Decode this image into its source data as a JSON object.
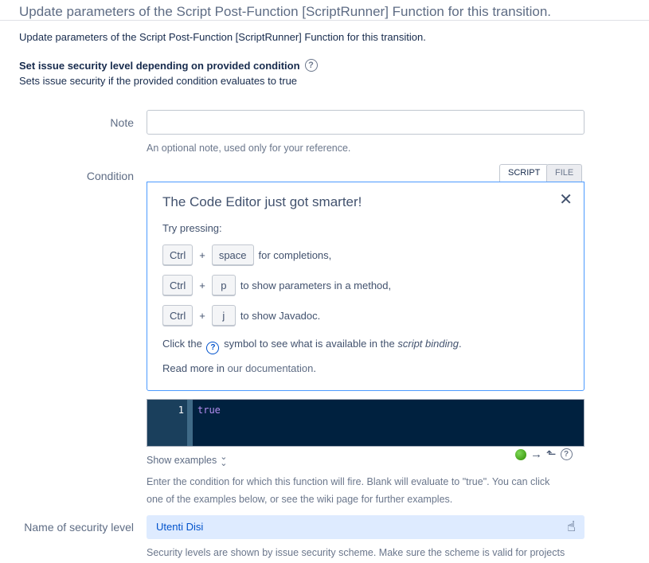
{
  "header": {
    "title": "Update parameters of the Script Post-Function [ScriptRunner] Function for this transition.",
    "intro": "Update parameters of the Script Post-Function [ScriptRunner] Function for this transition."
  },
  "function": {
    "title": "Set issue security level depending on provided condition",
    "help_icon": "question-circle-icon",
    "description": "Sets issue security if the provided condition evaluates to true"
  },
  "note": {
    "label": "Note",
    "value": "",
    "placeholder": "",
    "hint": "An optional note, used only for your reference."
  },
  "condition": {
    "label": "Condition",
    "tabs": [
      {
        "label": "SCRIPT",
        "active": true
      },
      {
        "label": "FILE",
        "active": false
      }
    ],
    "tip": {
      "title": "The Code Editor just got smarter!",
      "close_icon": "close-icon",
      "try_pressing": "Try pressing:",
      "shortcuts": [
        {
          "mod": "Ctrl",
          "plus": "+",
          "key": "space",
          "text": "for completions,"
        },
        {
          "mod": "Ctrl",
          "plus": "+",
          "key": "p",
          "text": "to show parameters in a method,"
        },
        {
          "mod": "Ctrl",
          "plus": "+",
          "key": "j",
          "text": "to show Javadoc."
        }
      ],
      "binding_pre": "Click the",
      "binding_mid": "symbol to see what is available in the",
      "binding_em": "script binding",
      "binding_post": ".",
      "read_more_pre": "Read more in",
      "read_more_link": "our documentation",
      "read_more_post": "."
    },
    "editor": {
      "line_number": "1",
      "code": "true"
    },
    "show_examples": "Show examples",
    "status_color": "#3fa31a",
    "hint_line1": "Enter the condition for which this function will fire. Blank will evaluate to \"true\". You can click",
    "hint_line2": "one of the examples below, or see the wiki page for further examples."
  },
  "security": {
    "label": "Name of security level",
    "selected": "Utenti Disi",
    "hint": "Security levels are shown by issue security scheme. Make sure the scheme is valid for projects"
  },
  "colors": {
    "accent": "#0052cc",
    "editor_bg": "#00213f",
    "select_bg": "#deebff",
    "tip_border": "#4c9aff"
  }
}
